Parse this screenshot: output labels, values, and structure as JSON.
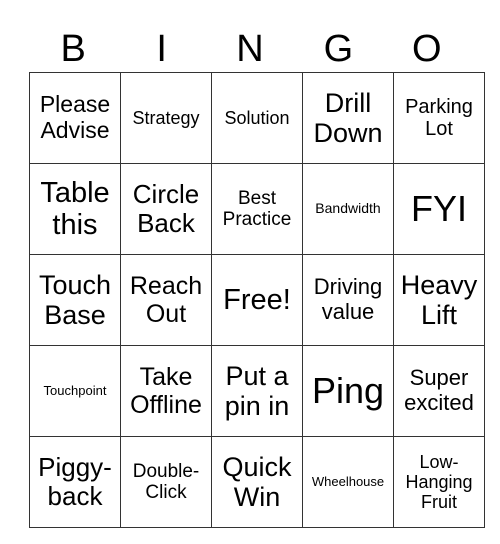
{
  "header": [
    "B",
    "I",
    "N",
    "G",
    "O"
  ],
  "cells": [
    [
      "Please Advise",
      "Strategy",
      "Solution",
      "Drill Down",
      "Parking Lot"
    ],
    [
      "Table this",
      "Circle Back",
      "Best Practice",
      "Bandwidth",
      "FYI"
    ],
    [
      "Touch Base",
      "Reach Out",
      "Free!",
      "Driving value",
      "Heavy Lift"
    ],
    [
      "Touchpoint",
      "Take Offline",
      "Put a pin in",
      "Ping",
      "Super excited"
    ],
    [
      "Piggy-back",
      "Double-Click",
      "Quick Win",
      "Wheelhouse",
      "Low-Hanging Fruit"
    ]
  ]
}
